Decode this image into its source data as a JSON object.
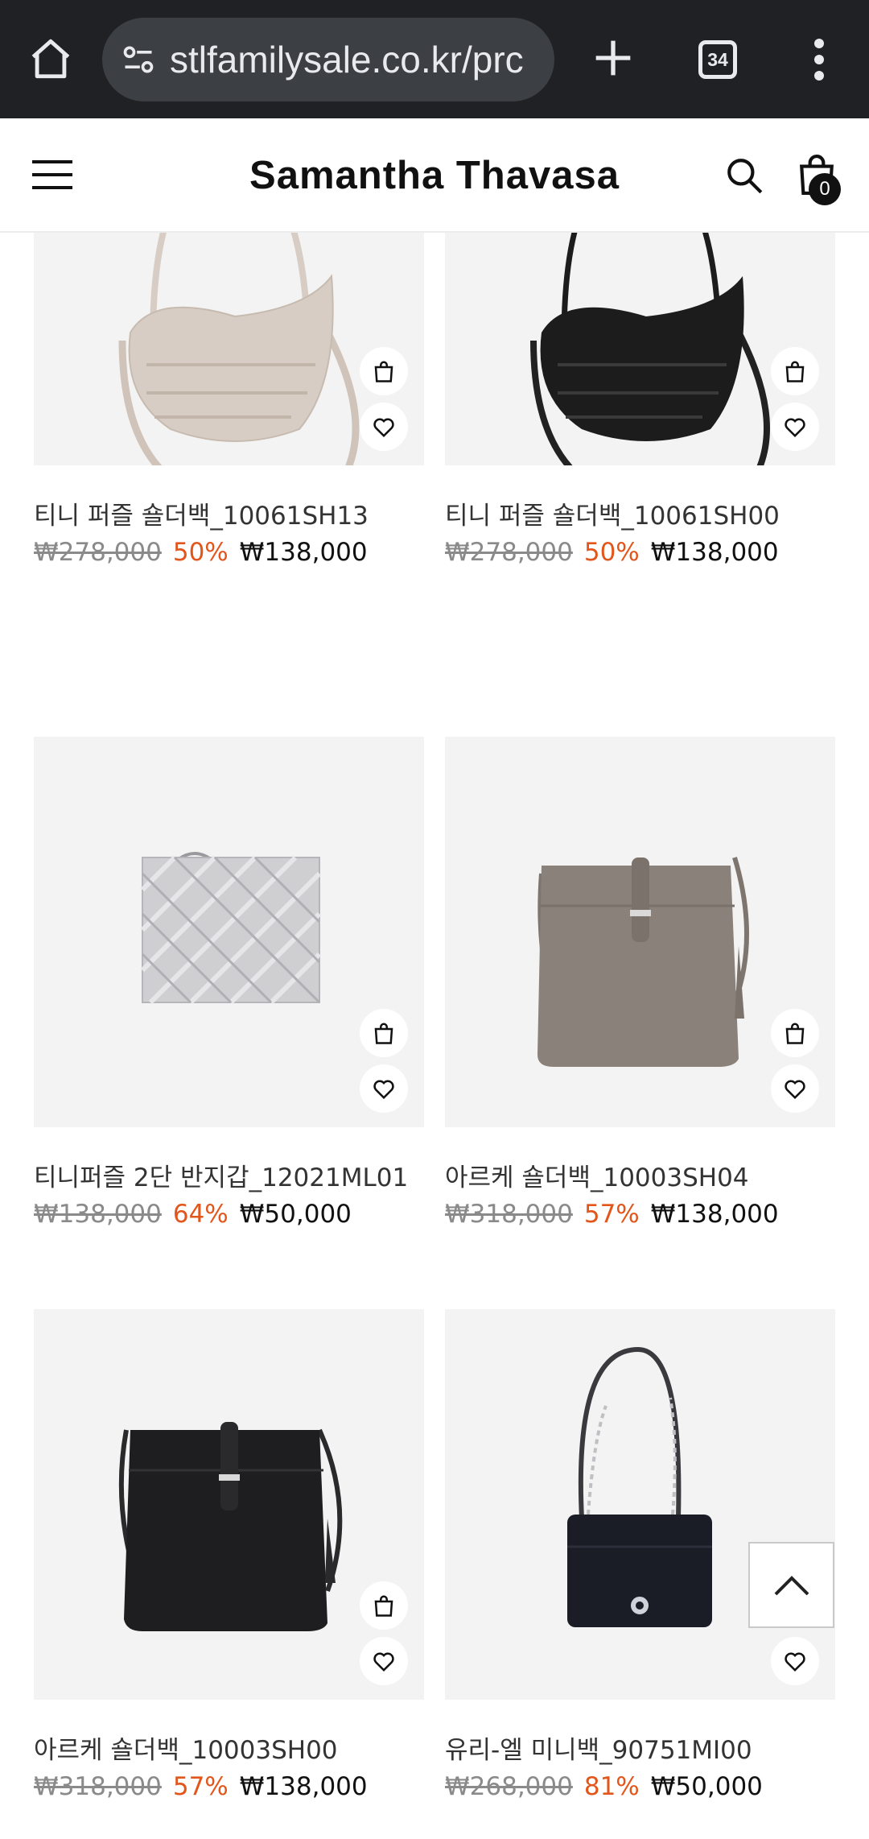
{
  "browser": {
    "url": "stlfamilysale.co.kr/prc",
    "tab_count": "34"
  },
  "header": {
    "logo": "Samantha Thavasa",
    "cart_count": "0"
  },
  "products": [
    {
      "name": "티니 퍼즐 숄더백_10061SH13",
      "original_price": "₩278,000",
      "discount": "50%",
      "sale_price": "₩138,000",
      "bag_color": "#d8cdc4"
    },
    {
      "name": "티니 퍼즐 숄더백_10061SH00",
      "original_price": "₩278,000",
      "discount": "50%",
      "sale_price": "₩138,000",
      "bag_color": "#1c1c1c"
    },
    {
      "name": "티니퍼즐 2단 반지갑_12021ML01",
      "original_price": "₩138,000",
      "discount": "64%",
      "sale_price": "₩50,000",
      "bag_color": "#cfcfd2"
    },
    {
      "name": "아르케 숄더백_10003SH04",
      "original_price": "₩318,000",
      "discount": "57%",
      "sale_price": "₩138,000",
      "bag_color": "#8a817a"
    },
    {
      "name": "아르케 숄더백_10003SH00",
      "original_price": "₩318,000",
      "discount": "57%",
      "sale_price": "₩138,000",
      "bag_color": "#1e1e20"
    },
    {
      "name": "유리-엘 미니백_90751MI00",
      "original_price": "₩268,000",
      "discount": "81%",
      "sale_price": "₩50,000",
      "bag_color": "#1a1d26"
    }
  ],
  "colors": {
    "discount": "#e2561b",
    "image_bg": "#f3f3f3",
    "browser_bg": "#1f2124"
  }
}
